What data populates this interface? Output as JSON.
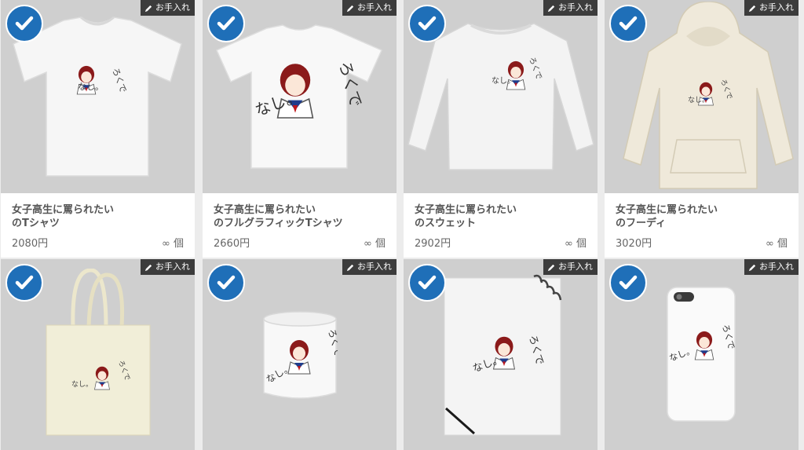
{
  "badge_label": "お手入れ",
  "currency_suffix": "円",
  "stock_label": "∞ 個",
  "colors": {
    "check_bg": "#1f6fb8",
    "card_bg": "#ffffff",
    "thumb_bg": "#cfcfcf",
    "badge_bg": "#3c3c3c"
  },
  "products": [
    {
      "name": "女子高生に罵られたい\nのTシャツ",
      "price": "2080円",
      "stock": "∞ 個",
      "badge": "お手入れ",
      "kind": "tshirt"
    },
    {
      "name": "女子高生に罵られたい\nのフルグラフィックTシャツ",
      "price": "2660円",
      "stock": "∞ 個",
      "badge": "お手入れ",
      "kind": "fullgraphic-tshirt"
    },
    {
      "name": "女子高生に罵られたい\nのスウェット",
      "price": "2902円",
      "stock": "∞ 個",
      "badge": "お手入れ",
      "kind": "sweatshirt"
    },
    {
      "name": "女子高生に罵られたい\nのフーディ",
      "price": "3020円",
      "stock": "∞ 個",
      "badge": "お手入れ",
      "kind": "hoodie"
    },
    {
      "badge": "お手入れ",
      "kind": "tote-bag"
    },
    {
      "badge": "お手入れ",
      "kind": "mug"
    },
    {
      "badge": "お手入れ",
      "kind": "notebook"
    },
    {
      "badge": "お手入れ",
      "kind": "phone-case"
    }
  ],
  "artwork": {
    "text_line1": "ろくで",
    "text_line2": "なし。"
  }
}
